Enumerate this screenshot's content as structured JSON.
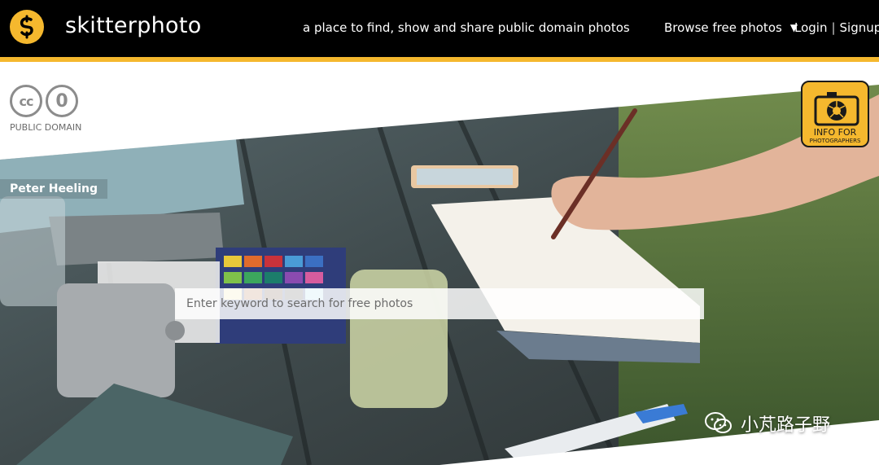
{
  "header": {
    "brand": "skitterphoto",
    "tagline": "a place to find, show and share public domain photos",
    "browse_label": "Browse free photos",
    "browse_caret": "▼",
    "login_label": "Login",
    "separator": "|",
    "signup_label": "Signup"
  },
  "license": {
    "cc_text": "cc",
    "zero_text": "0",
    "label": "PUBLIC DOMAIN"
  },
  "info_badge": {
    "line1": "INFO FOR",
    "line2": "PHOTOGRAPHERS"
  },
  "photo": {
    "credit": "Peter Heeling"
  },
  "search": {
    "placeholder": "Enter keyword to search for free photos",
    "value": ""
  },
  "watermark": {
    "text": "小芃路子野"
  },
  "colors": {
    "header_bg": "#000000",
    "accent": "#f5b82e",
    "text_light": "#ffffff"
  },
  "icons": {
    "logo": "skitterphoto-logo-icon",
    "caret": "caret-down-icon",
    "camera": "camera-icon",
    "watermark": "wechat-icon"
  }
}
